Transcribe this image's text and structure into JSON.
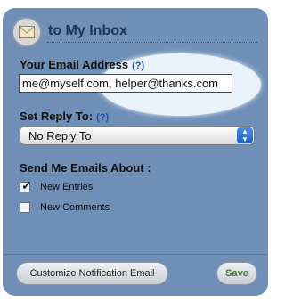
{
  "header": {
    "title": "to My Inbox",
    "icon": "envelope-icon"
  },
  "email": {
    "label": "Your Email Address",
    "help": "(?)",
    "value": "me@myself.com, helper@thanks.com"
  },
  "reply": {
    "label": "Set Reply To:",
    "help": "(?)",
    "selected": "No Reply To"
  },
  "send_about": {
    "label": "Send Me Emails About :",
    "options": [
      {
        "label": "New Entries",
        "checked": true
      },
      {
        "label": "New Comments",
        "checked": false
      }
    ]
  },
  "footer": {
    "customize_label": "Customize Notification Email",
    "save_label": "Save"
  },
  "colors": {
    "panel": "#6f8fb7",
    "title": "#1d3557",
    "help": "#1f4fa3",
    "save": "#3f7a2f",
    "highlight": "#e8f3fb"
  }
}
